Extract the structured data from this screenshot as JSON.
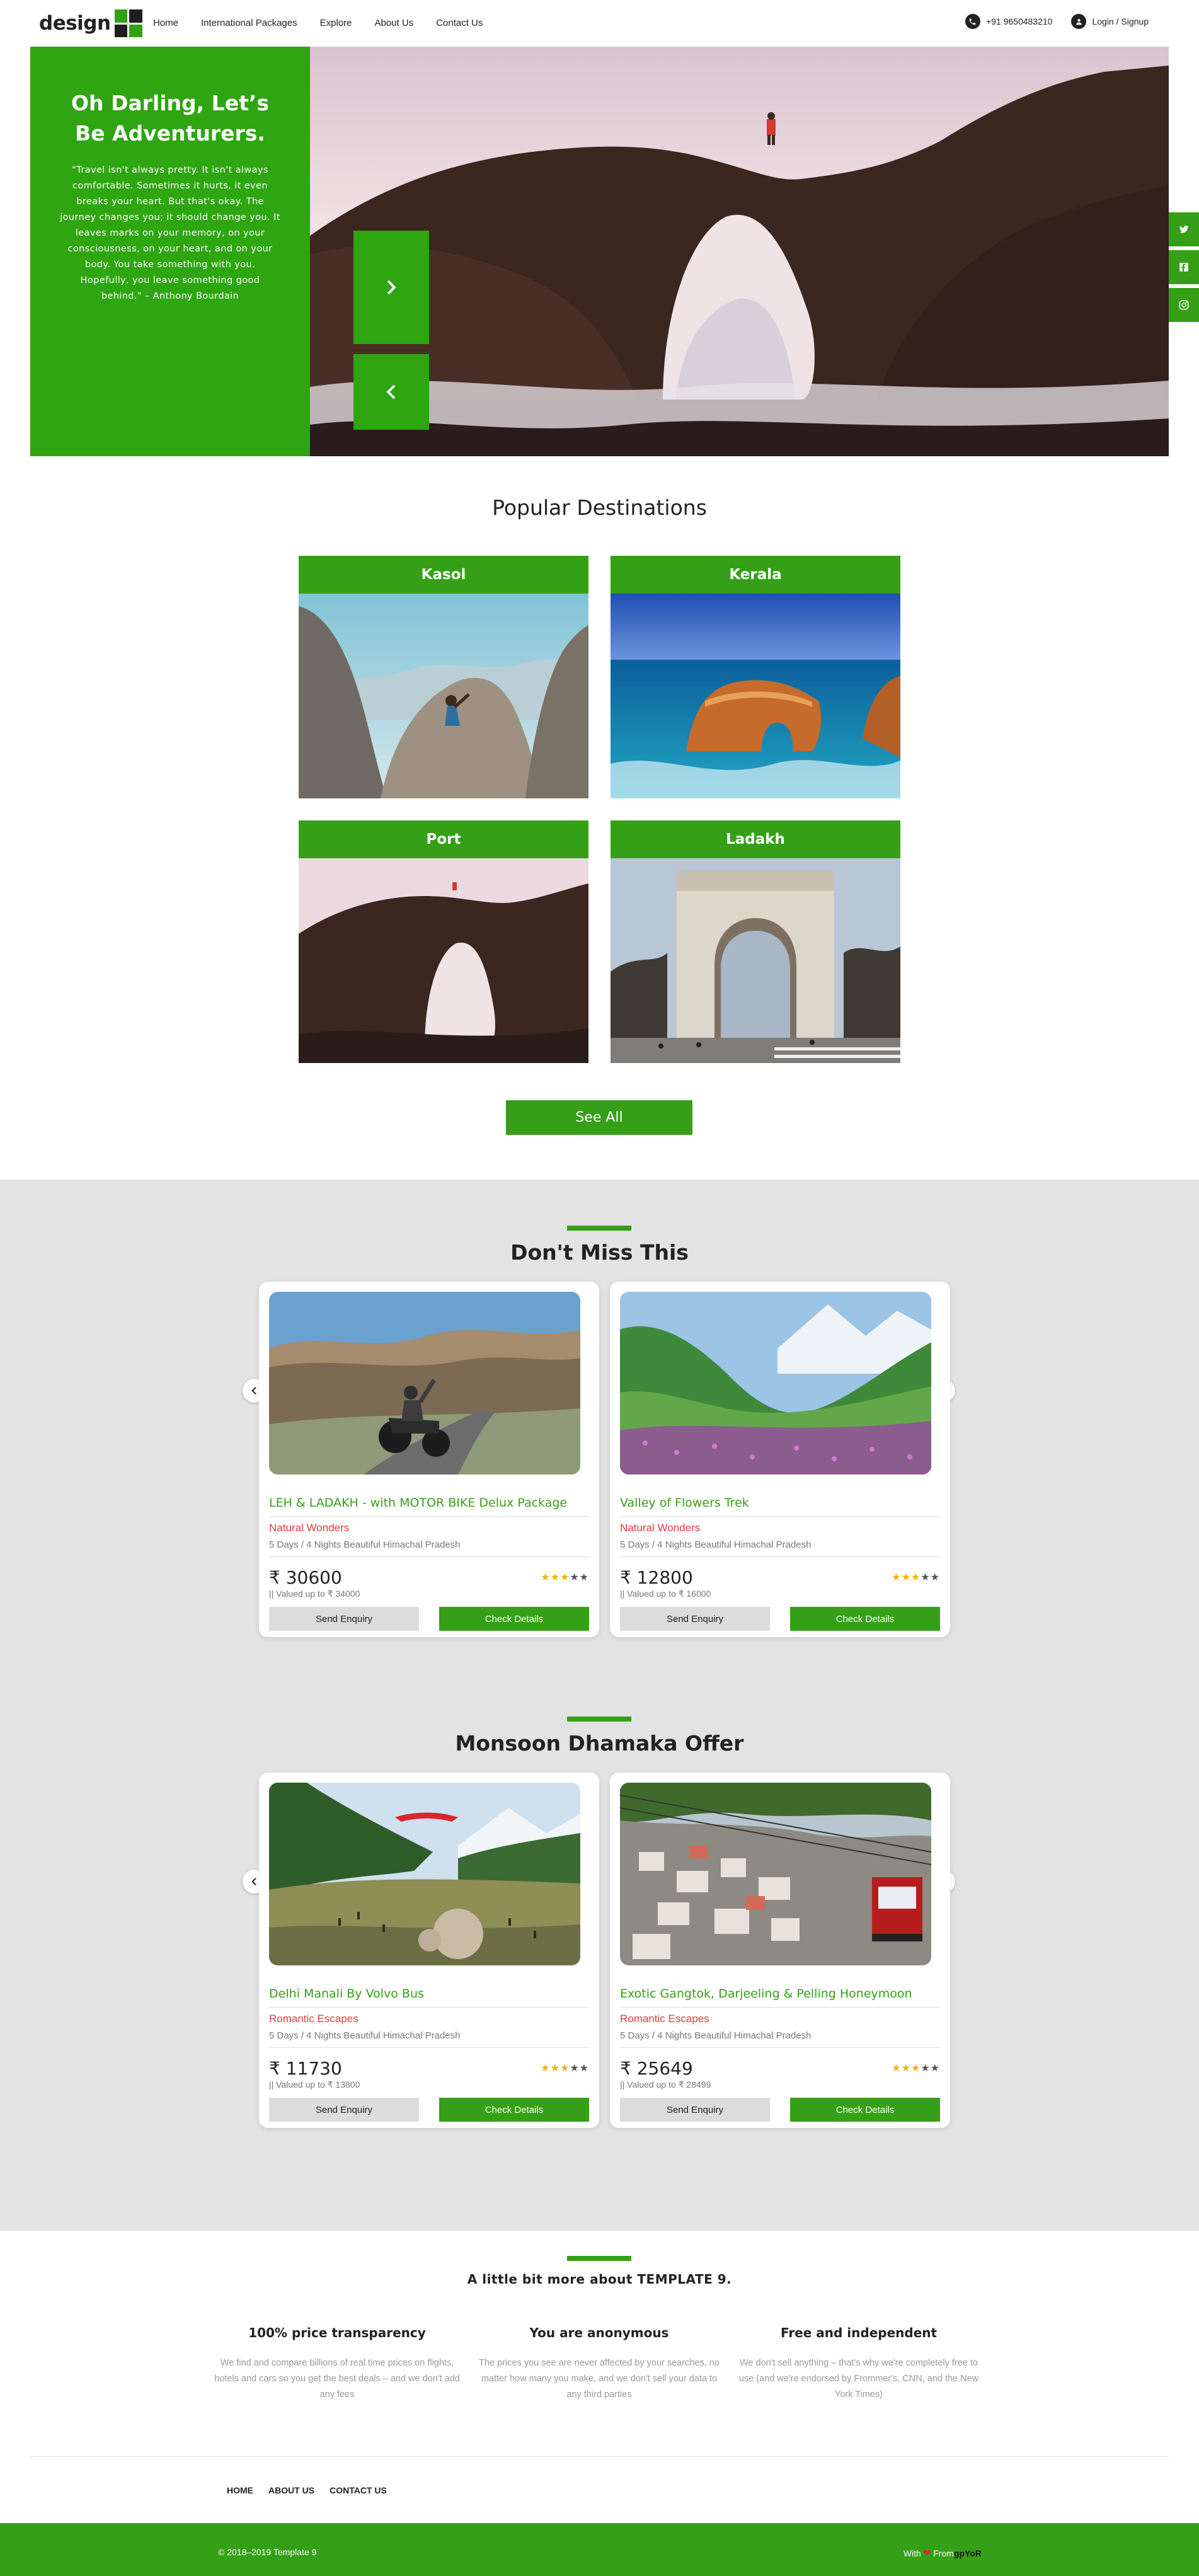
{
  "colors": {
    "brand_green": "#35a017",
    "hero_panel_green": "#2ea511",
    "accent_red": "#e03c3c",
    "gray_band": "#e3e3e3",
    "star_gold": "#f1b400"
  },
  "header": {
    "logo_text": "design",
    "nav": [
      "Home",
      "International Packages",
      "Explore",
      "About Us",
      "Contact Us"
    ],
    "phone": "+91 9650483210",
    "phone_icon": "phone-icon",
    "login": "Login / Signup",
    "login_icon": "user-icon"
  },
  "hero": {
    "title": "Oh Darling, Let’s Be Adventurers.",
    "quote": "\"Travel isn't always pretty. It isn't always comfortable. Sometimes it hurts, it even breaks your heart. But that's okay. The journey changes you; it should change you. It leaves marks on your memory, on your consciousness, on your heart, and on your body. You take something with you. Hopefully, you leave something good behind.\" – Anthony Bourdain",
    "next_icon": "chevron-right-icon",
    "prev_icon": "chevron-left-icon"
  },
  "social": [
    "twitter-icon",
    "facebook-icon",
    "instagram-icon"
  ],
  "popular": {
    "title": "Popular Destinations",
    "destinations": [
      "Kasol",
      "Kerala",
      "Port",
      "Ladakh"
    ],
    "see_all": "See All"
  },
  "sections": [
    {
      "title": "Don't Miss This",
      "cards": [
        {
          "title": "LEH & LADAKH - with MOTOR BIKE Delux Package",
          "category": "Natural Wonders",
          "subtitle": "5 Days / 4 Nights Beautiful Himachal Pradesh",
          "price": "₹ 30600",
          "valued": "|| Valued up to ₹ 34000",
          "rating": 3,
          "rating_max": 5,
          "enquiry": "Send Enquiry",
          "details": "Check Details"
        },
        {
          "title": "Valley of Flowers Trek",
          "category": "Natural Wonders",
          "subtitle": "5 Days / 4 Nights Beautiful Himachal Pradesh",
          "price": "₹ 12800",
          "valued": "|| Valued up to ₹ 16000",
          "rating": 3,
          "rating_max": 5,
          "enquiry": "Send Enquiry",
          "details": "Check Details"
        }
      ]
    },
    {
      "title": "Monsoon Dhamaka Offer",
      "cards": [
        {
          "title": "Delhi Manali By Volvo Bus",
          "category": "Romantic Escapes",
          "subtitle": "5 Days / 4 Nights Beautiful Himachal Pradesh",
          "price": "₹ 11730",
          "valued": "|| Valued up to ₹ 13800",
          "rating": 3,
          "rating_max": 5,
          "enquiry": "Send Enquiry",
          "details": "Check Details"
        },
        {
          "title": "Exotic Gangtok, Darjeeling & Pelling Honeymoon",
          "category": "Romantic Escapes",
          "subtitle": "5 Days / 4 Nights Beautiful Himachal Pradesh",
          "price": "₹ 25649",
          "valued": "|| Valued up to ₹ 28499",
          "rating": 3,
          "rating_max": 5,
          "enquiry": "Send Enquiry",
          "details": "Check Details"
        }
      ]
    }
  ],
  "about": {
    "title": "A little bit more about TEMPLATE 9.",
    "features": [
      {
        "title": "100% price transparency",
        "text": "We find and compare billions of real time prices on flights, hotels and cars so you get the best deals – and we don't add any fees"
      },
      {
        "title": "You are anonymous",
        "text": "The prices you see are never affected by your searches, no matter how many you make, and we don't sell your data to any third parties"
      },
      {
        "title": "Free and independent",
        "text": "We don't sell anything – that's why we're completely free to use (and we're endorsed by Frommer's, CNN, and the New York Times)"
      }
    ]
  },
  "footer": {
    "links": [
      "HOME",
      "ABOUT US",
      "CONTACT US"
    ],
    "copyright": "© 2018–2019 Template 9",
    "made_with": "With",
    "heart_icon": "heart-icon",
    "from": "From",
    "brand": "gpYoR"
  }
}
